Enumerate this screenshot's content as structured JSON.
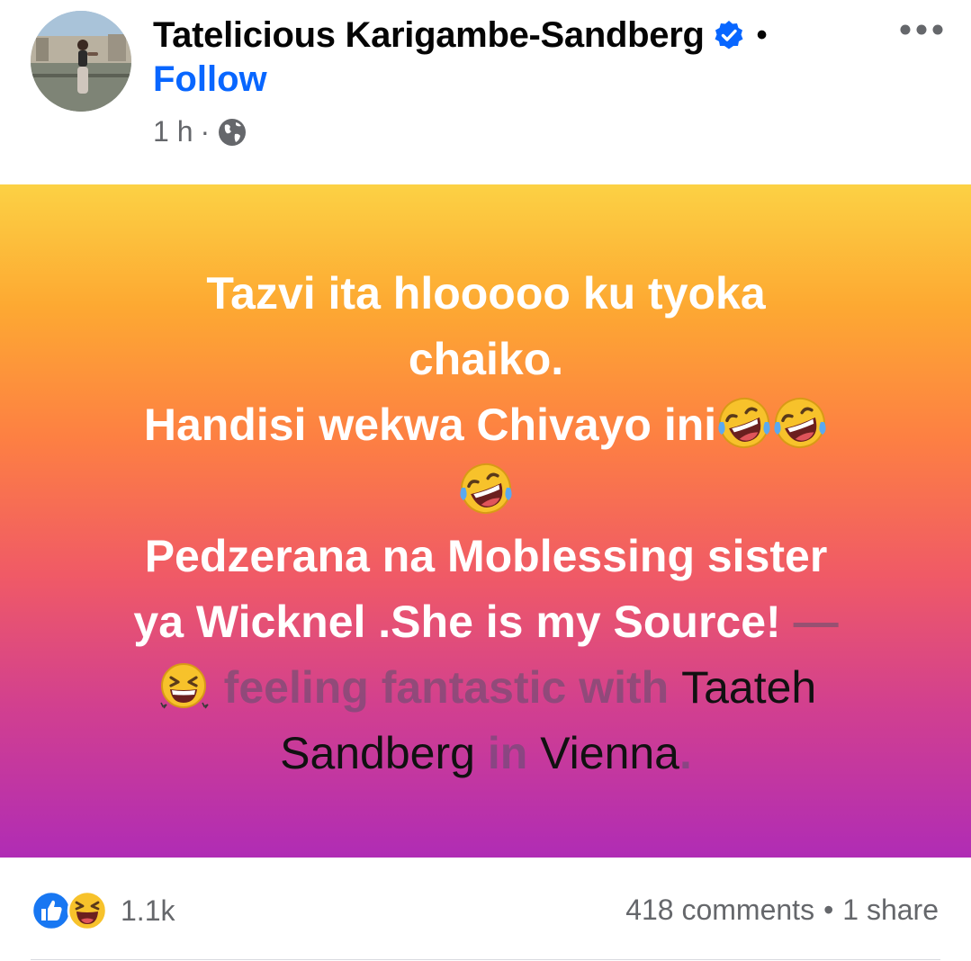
{
  "author": {
    "name": "Tatelicious Karigambe-Sandberg",
    "follow_label": "Follow",
    "separator": "•"
  },
  "meta": {
    "time": "1 h",
    "dot": "·",
    "audience_icon": "globe-icon"
  },
  "post": {
    "lines": [
      "Tazvi ita hlooooo ku tyoka",
      "chaiko.",
      "Handisi wekwa Chivayo ini",
      "Pedzerana na Moblessing sister",
      "ya Wicknel .She is my Source!"
    ],
    "dash": "—",
    "feeling_text": "feeling fantastic with",
    "tagged_first": "Taateh",
    "tagged_last": "Sandberg",
    "in_text": "in",
    "location": "Vienna",
    "period": ".",
    "emoji": "rofl-emoji",
    "feeling_emoji": "grinning-squint-emoji",
    "gradient": [
      "#fcd144",
      "#fd7f43",
      "#f05a66",
      "#b02cb5"
    ]
  },
  "footer": {
    "reaction_count": "1.1k",
    "comments": "418 comments",
    "bullet": "•",
    "shares": "1 share",
    "reaction_icons": [
      "like-icon",
      "haha-icon"
    ]
  },
  "colors": {
    "link_blue": "#0866ff",
    "secondary_text": "#65676b",
    "verified_blue": "#0866ff"
  }
}
